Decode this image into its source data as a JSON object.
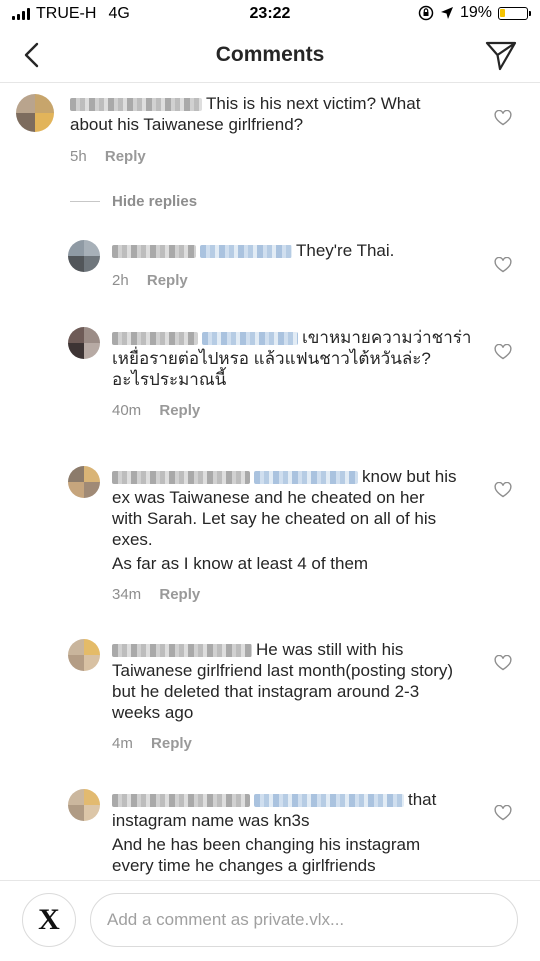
{
  "status_bar": {
    "carrier": "TRUE-H",
    "network": "4G",
    "time": "23:22",
    "battery_percent": "19%",
    "battery_level": 0.19
  },
  "header": {
    "title": "Comments",
    "back_icon": "chevron-left-icon",
    "send_icon": "paper-plane-icon"
  },
  "comments": [
    {
      "text": "This is his next victim? What about his Taiwanese girlfriend?",
      "time": "5h",
      "reply_label": "Reply"
    }
  ],
  "hide_replies_label": "Hide replies",
  "replies": [
    {
      "text": "They're Thai.",
      "time": "2h",
      "reply_label": "Reply"
    },
    {
      "text": "เขาหมายความว่าชาร่าเหยื่อรายต่อไปหรอ แล้วแฟนชาวไต้หวันล่ะ? อะไรประมาณนี้",
      "time": "40m",
      "reply_label": "Reply"
    },
    {
      "text": "know but his ex was Taiwanese and he cheated on her with Sarah. Let say he cheated on all of his exes.",
      "text2": "As far as I know at least 4 of them",
      "time": "34m",
      "reply_label": "Reply"
    },
    {
      "text": "He was still with his Taiwanese girlfriend last month(posting story) but he deleted that instagram around 2-3 weeks ago",
      "time": "4m",
      "reply_label": "Reply"
    },
    {
      "text": "that instagram name was kn3s",
      "text2": "And he has been changing his instagram every time he changes a girlfriends"
    }
  ],
  "input": {
    "placeholder": "Add a comment as private.vlx...",
    "value": "",
    "own_avatar_letter": "X"
  },
  "colors": {
    "text": "#262626",
    "meta": "#8e8e8e",
    "divider": "#e6e6e6",
    "battery": "#f5c300"
  }
}
